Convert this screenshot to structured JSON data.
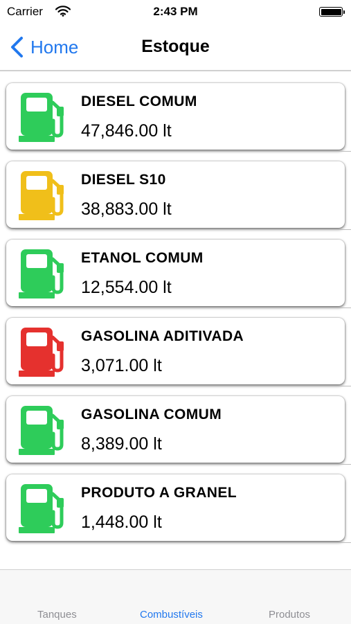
{
  "status_bar": {
    "carrier": "Carrier",
    "time": "2:43 PM"
  },
  "nav": {
    "back_label": "Home",
    "title": "Estoque"
  },
  "products": [
    {
      "name": "DIESEL COMUM",
      "quantity": "47,846.00 lt",
      "icon": "fuel-pump-icon",
      "color": "#2ecc5a"
    },
    {
      "name": "DIESEL S10",
      "quantity": "38,883.00 lt",
      "icon": "fuel-pump-icon",
      "color": "#f0bf1a"
    },
    {
      "name": "ETANOL COMUM",
      "quantity": "12,554.00 lt",
      "icon": "fuel-pump-icon",
      "color": "#2ecc5a"
    },
    {
      "name": "GASOLINA ADITIVADA",
      "quantity": "3,071.00 lt",
      "icon": "fuel-pump-icon",
      "color": "#e5312e"
    },
    {
      "name": "GASOLINA COMUM",
      "quantity": "8,389.00 lt",
      "icon": "fuel-pump-icon",
      "color": "#2ecc5a"
    },
    {
      "name": "PRODUTO A GRANEL",
      "quantity": "1,448.00 lt",
      "icon": "fuel-pump-icon",
      "color": "#2ecc5a"
    }
  ],
  "tabs": [
    {
      "label": "Tanques",
      "active": false
    },
    {
      "label": "Combustíveis",
      "active": true
    },
    {
      "label": "Produtos",
      "active": false
    }
  ],
  "colors": {
    "accent": "#2178ee",
    "inactive_tab": "#8e8e93"
  }
}
